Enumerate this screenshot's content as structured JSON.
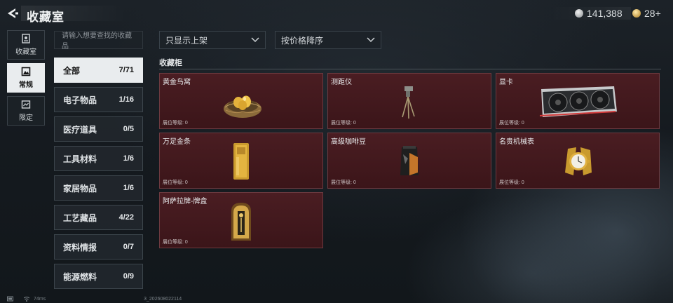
{
  "header": {
    "title": "收藏室"
  },
  "currency": {
    "silver": "141,388",
    "gold": "28+"
  },
  "nav": [
    {
      "label": "收藏室",
      "icon": "collection-room-icon"
    },
    {
      "label": "常规",
      "icon": "regular-icon",
      "active": true
    },
    {
      "label": "限定",
      "icon": "limited-icon"
    }
  ],
  "search": {
    "placeholder": "请输入想要查找的收藏品"
  },
  "filters": {
    "shelf": "只显示上架",
    "sort": "按价格降序"
  },
  "categories": [
    {
      "label": "全部",
      "count": "7/71"
    },
    {
      "label": "电子物品",
      "count": "1/16"
    },
    {
      "label": "医疗道具",
      "count": "0/5"
    },
    {
      "label": "工具材料",
      "count": "1/6"
    },
    {
      "label": "家居物品",
      "count": "1/6"
    },
    {
      "label": "工艺藏品",
      "count": "4/22"
    },
    {
      "label": "资料情报",
      "count": "0/7"
    },
    {
      "label": "能源燃料",
      "count": "0/9"
    }
  ],
  "section": {
    "title": "收藏柜"
  },
  "items": [
    {
      "name": "黄金鸟窝",
      "level": "展位等级: 0",
      "icon": "golden-nest-icon"
    },
    {
      "name": "测距仪",
      "level": "展位等级: 0",
      "icon": "rangefinder-icon"
    },
    {
      "name": "显卡",
      "level": "展位等级: 0",
      "icon": "graphics-card-icon"
    },
    {
      "name": "万足金条",
      "level": "展位等级: 0",
      "icon": "gold-bar-icon"
    },
    {
      "name": "高级咖啡豆",
      "level": "展位等级: 0",
      "icon": "coffee-bag-icon"
    },
    {
      "name": "名贵机械表",
      "level": "展位等级: 0",
      "icon": "watch-icon"
    },
    {
      "name": "阿萨拉牌-牌盒",
      "level": "展位等级: 0",
      "icon": "card-box-icon"
    }
  ],
  "status": {
    "ping": "74ms",
    "build": "3_202608022114"
  }
}
